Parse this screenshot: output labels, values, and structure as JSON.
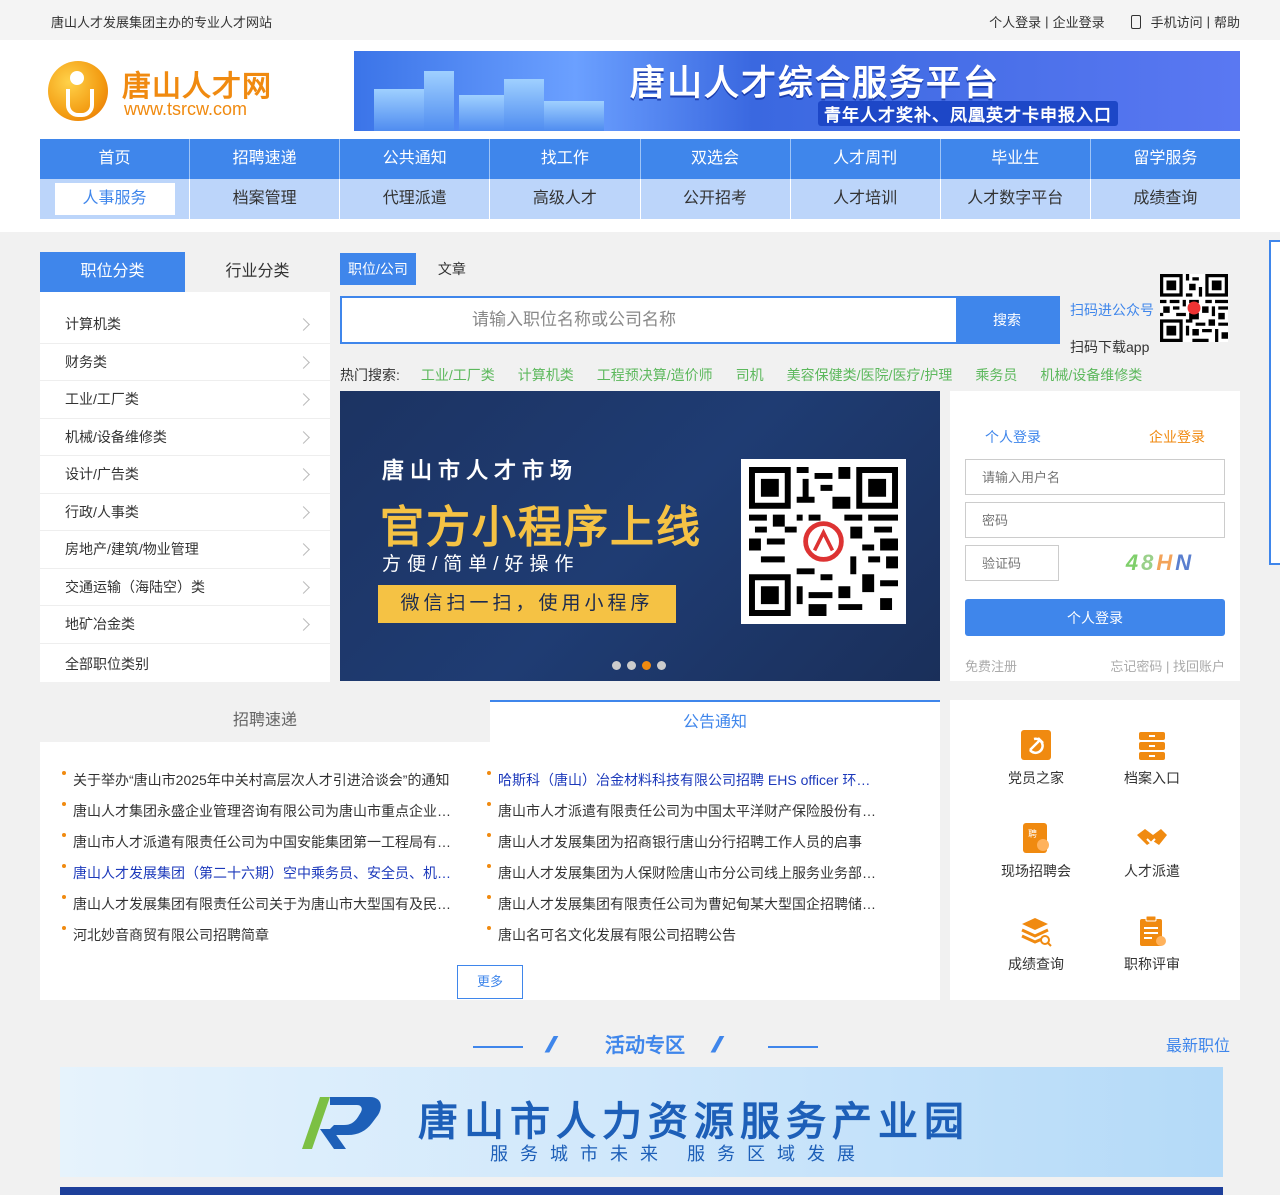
{
  "topbar": {
    "slogan": "唐山人才发展集团主办的专业人才网站",
    "personal_login": "个人登录",
    "sep1": "|",
    "company_login": "企业登录",
    "mobile": "手机访问",
    "sep2": "|",
    "help": "帮助"
  },
  "logo": {
    "name": "唐山人才网",
    "url": "www.tsrcw.com"
  },
  "top_banner": {
    "title": "唐山人才综合服务平台",
    "subtitle": "青年人才奖补、凤凰英才卡申报入口"
  },
  "nav": {
    "row1": [
      "首页",
      "招聘速递",
      "公共通知",
      "找工作",
      "双选会",
      "人才周刊",
      "毕业生",
      "留学服务"
    ],
    "row2": [
      "人事服务",
      "档案管理",
      "代理派遣",
      "高级人才",
      "公开招考",
      "人才培训",
      "人才数字平台",
      "成绩查询"
    ]
  },
  "category": {
    "tab_position": "职位分类",
    "tab_industry": "行业分类",
    "items": [
      "计算机类",
      "财务类",
      "工业/工厂类",
      "机械/设备维修类",
      "设计/广告类",
      "行政/人事类",
      "房地产/建筑/物业管理",
      "交通运输（海陆空）类",
      "地矿冶金类"
    ],
    "all": "全部职位类别"
  },
  "search": {
    "tab_job": "职位/公司",
    "tab_article": "文章",
    "placeholder": "请输入职位名称或公司名称",
    "button": "搜索",
    "qr_wechat": "扫码进公众号",
    "qr_app": "扫码下载app"
  },
  "hot": {
    "label": "热门搜索:",
    "items": [
      "工业/工厂类",
      "计算机类",
      "工程预决算/造价师",
      "司机",
      "美容保健类/医院/医疗/护理",
      "乘务员",
      "机械/设备维修类"
    ]
  },
  "slider": {
    "line1": "唐山市人才市场",
    "line2": "官方小程序上线",
    "line3": "方便/简单/好操作",
    "line4": "微信扫一扫，使用小程序",
    "active_dot": 3,
    "dot_count": 4
  },
  "login": {
    "tab_personal": "个人登录",
    "tab_company": "企业登录",
    "username_placeholder": "请输入用户名",
    "password_placeholder": "密码",
    "captcha_placeholder": "验证码",
    "captcha_text": "48HN",
    "button": "个人登录",
    "register": "免费注册",
    "forgot": "忘记密码 | 找回账户"
  },
  "news": {
    "tab_recruit": "招聘速递",
    "tab_notice": "公告通知",
    "left": [
      "关于举办“唐山市2025年中关村高层次人才引进洽谈会”的通知",
      "唐山人才集团永盛企业管理咨询有限公司为唐山市重点企业招聘",
      "唐山市人才派遣有限责任公司为中国安能集团第一工程局有限公司",
      "唐山人才发展集团（第二十六期）空中乘务员、安全员、机场地勤",
      "唐山人才发展集团有限责任公司关于为唐山市大型国有及民营企业",
      "河北妙音商贸有限公司招聘简章"
    ],
    "right": [
      "哈斯科（唐山）冶金材料科技有限公司招聘 EHS officer 环境健康安全",
      "唐山市人才派遣有限责任公司为中国太平洋财产保险股份有限公司",
      "唐山人才发展集团为招商银行唐山分行招聘工作人员的启事",
      "唐山人才发展集团为人保财险唐山市分公司线上服务业务部招聘",
      "唐山人才发展集团有限责任公司为曹妃甸某大型国企招聘储备干部",
      "唐山名可名文化发展有限公司招聘公告"
    ],
    "more": "更多"
  },
  "services": [
    "党员之家",
    "档案入口",
    "现场招聘会",
    "人才派遣",
    "成绩查询",
    "职称评审"
  ],
  "activity": {
    "title": "活动专区",
    "newest": "最新职位"
  },
  "banner2": {
    "title": "唐山市人力资源服务产业园",
    "subtitle": "服务城市未来 服务区域发展"
  },
  "colors": {
    "primary": "#3f86eb",
    "accent": "#f08a10",
    "hot": "#5cb85c"
  }
}
